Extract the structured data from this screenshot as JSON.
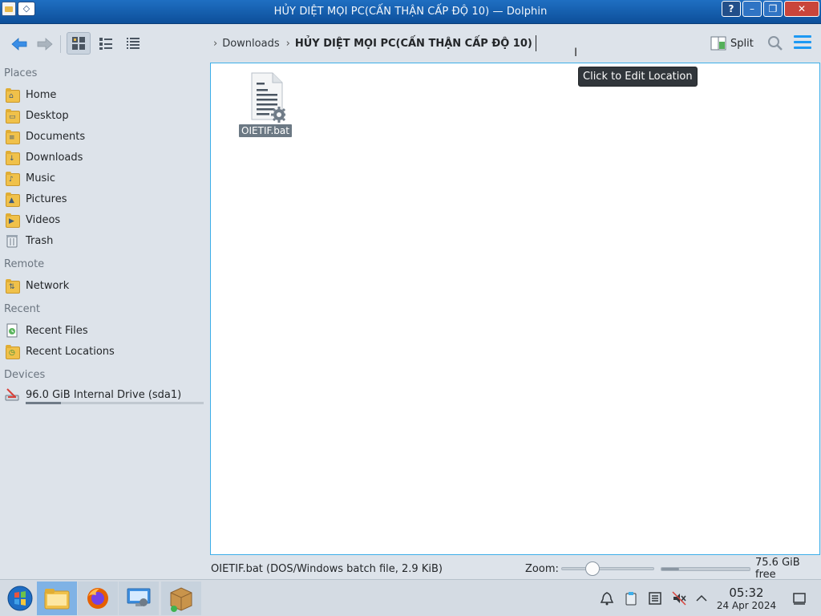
{
  "window": {
    "title": "HỦY DIỆT MỌI PC(CẤN THẬN CẤP ĐỘ 10) — Dolphin",
    "buttons": [
      "?",
      "–",
      "❐",
      "✕"
    ]
  },
  "toolbar": {
    "breadcrumb": [
      {
        "label": "Downloads"
      },
      {
        "label": "HỦY DIỆT MỌI PC(CẤN THẬN CẤP ĐỘ 10)"
      }
    ],
    "split_label": "Split"
  },
  "tooltip": "Click to Edit Location",
  "sidebar": {
    "sections": [
      {
        "label": "Places"
      },
      {
        "label": "Remote"
      },
      {
        "label": "Recent"
      },
      {
        "label": "Devices"
      }
    ],
    "places": [
      {
        "label": "Home",
        "icon": "home-folder-icon"
      },
      {
        "label": "Desktop",
        "icon": "desktop-folder-icon"
      },
      {
        "label": "Documents",
        "icon": "documents-folder-icon"
      },
      {
        "label": "Downloads",
        "icon": "downloads-folder-icon"
      },
      {
        "label": "Music",
        "icon": "music-folder-icon"
      },
      {
        "label": "Pictures",
        "icon": "pictures-folder-icon"
      },
      {
        "label": "Videos",
        "icon": "videos-folder-icon"
      },
      {
        "label": "Trash",
        "icon": "trash-icon"
      }
    ],
    "remote": [
      {
        "label": "Network",
        "icon": "network-folder-icon"
      }
    ],
    "recent": [
      {
        "label": "Recent Files",
        "icon": "recent-files-icon"
      },
      {
        "label": "Recent Locations",
        "icon": "recent-locations-icon"
      }
    ],
    "devices": [
      {
        "label": "96.0 GiB Internal Drive (sda1)",
        "icon": "drive-icon",
        "used_fraction": 0.2
      }
    ]
  },
  "files": [
    {
      "name": "OIETIF.bat",
      "icon": "batch-file-icon",
      "selected": true
    }
  ],
  "statusbar": {
    "info": "OIETIF.bat (DOS/Windows batch file, 2.9 KiB)",
    "zoom_label": "Zoom:",
    "zoom_fraction": 0.3,
    "free_space": "75.6 GiB free",
    "used_fraction": 0.2
  },
  "taskbar": {
    "apps": [
      {
        "name": "application-launcher-icon"
      },
      {
        "name": "file-manager-icon"
      },
      {
        "name": "firefox-icon"
      },
      {
        "name": "system-settings-icon"
      },
      {
        "name": "package-installer-icon"
      }
    ],
    "tray": [
      "notifications-icon",
      "clipboard-icon",
      "task-manager-icon",
      "volume-muted-icon",
      "expand-tray-icon"
    ],
    "time": "05:32",
    "date": "24 Apr 2024"
  },
  "colors": {
    "accent": "#3daee9",
    "titlebar": "#1565c0",
    "selection": "#6c7984"
  }
}
